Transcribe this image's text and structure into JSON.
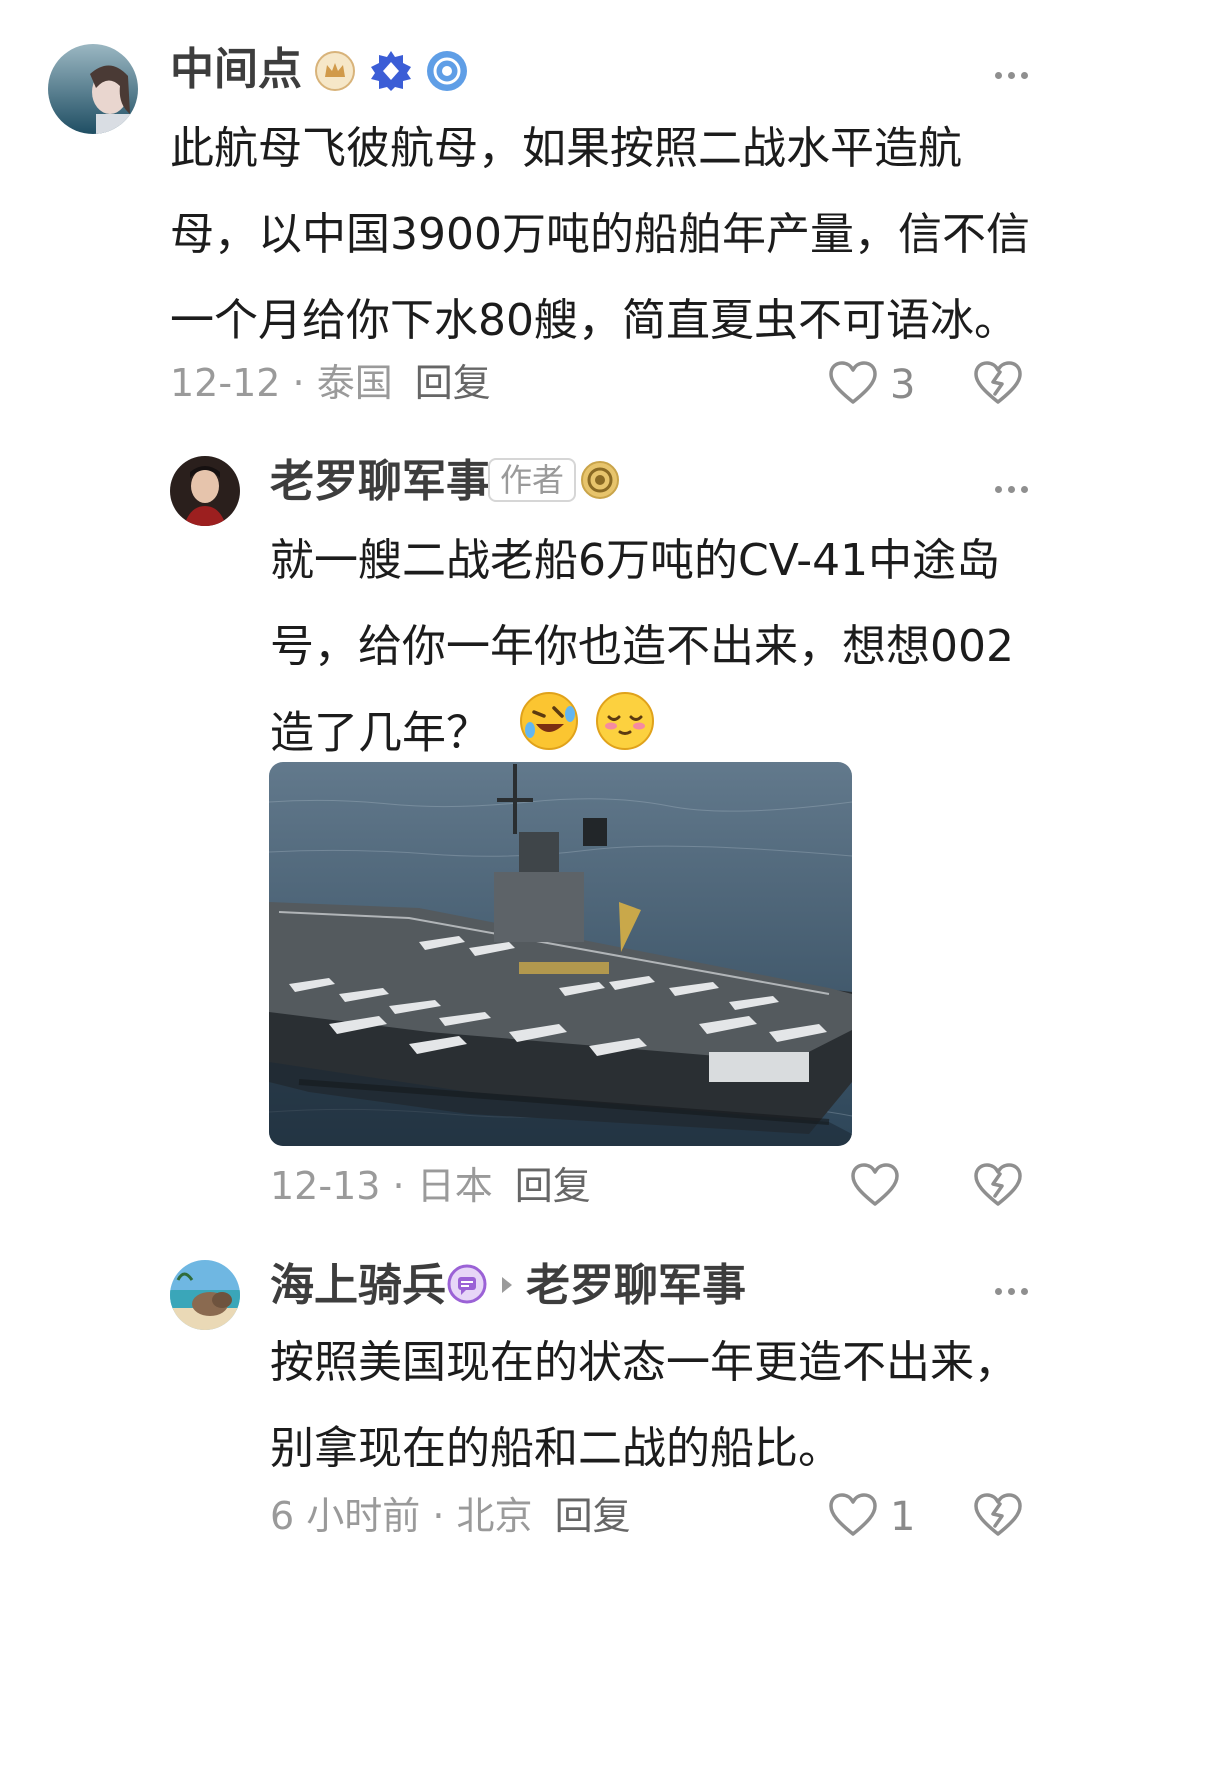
{
  "comments": [
    {
      "username": "中间点",
      "text": "此航母飞彼航母，如果按照二战水平造航母，以中国3900万吨的船舶年产量，信不信一个月给你下水80艘，简直夏虫不可语冰。",
      "lines": [
        "此航母飞彼航母，如果按照二战水平造航",
        "母，以中国3900万吨的船舶年产量，信不信",
        "一个月给你下水80艘，简直夏虫不可语冰。"
      ],
      "date": "12-12",
      "location": "泰国",
      "reply_label": "回复",
      "likes": "3",
      "badges": [
        "crown-badge",
        "diamond-badge",
        "target-badge"
      ]
    },
    {
      "username": "老罗聊军事",
      "author_tag": "作者",
      "lines": [
        "就一艘二战老船6万吨的CV-41中途岛",
        "号，给你一年你也造不出来，想想002",
        "造了几年？"
      ],
      "emojis": [
        "rofl-emoji",
        "blush-emoji"
      ],
      "date": "12-13",
      "location": "日本",
      "reply_label": "回复",
      "likes": "",
      "badges": [
        "target-badge"
      ]
    },
    {
      "username": "海上骑兵",
      "reply_to": "老罗聊军事",
      "lines": [
        "按照美国现在的状态一年更造不出来，",
        "别拿现在的船和二战的船比。"
      ],
      "date": "6 小时前",
      "location": "北京",
      "reply_label": "回复",
      "likes": "1",
      "badges": [
        "message-badge"
      ]
    }
  ],
  "colors": {
    "text": "#1c1c1c",
    "meta": "#9a9a9a",
    "icon": "#8f8f8f"
  }
}
